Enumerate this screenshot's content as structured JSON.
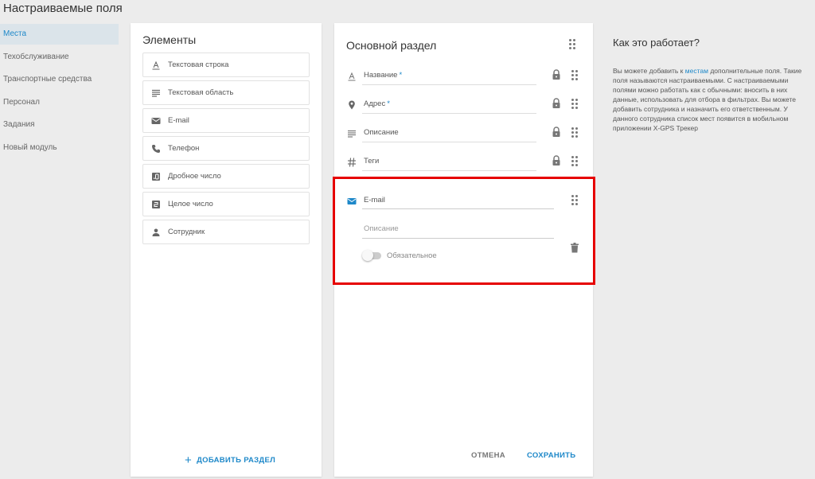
{
  "page_title": "Настраиваемые поля",
  "sidebar": {
    "items": [
      {
        "label": "Места",
        "active": true
      },
      {
        "label": "Техобслуживание"
      },
      {
        "label": "Транспортные средства"
      },
      {
        "label": "Персонал"
      },
      {
        "label": "Задания"
      },
      {
        "label": "Новый модуль"
      }
    ]
  },
  "elements_panel": {
    "title": "Элементы",
    "items": [
      {
        "label": "Текстовая строка",
        "icon": "text-line-icon"
      },
      {
        "label": "Текстовая область",
        "icon": "text-area-icon"
      },
      {
        "label": "E-mail",
        "icon": "email-icon"
      },
      {
        "label": "Телефон",
        "icon": "phone-icon"
      },
      {
        "label": "Дробное число",
        "icon": "decimal-icon"
      },
      {
        "label": "Целое число",
        "icon": "integer-icon"
      },
      {
        "label": "Сотрудник",
        "icon": "person-icon"
      }
    ],
    "add_section": "ДОБАВИТЬ РАЗДЕЛ"
  },
  "section_panel": {
    "title": "Основной раздел",
    "fields": [
      {
        "label": "Название",
        "required": "*",
        "icon": "text-line-icon"
      },
      {
        "label": "Адрес",
        "required": "*",
        "icon": "location-pin-icon"
      },
      {
        "label": "Описание",
        "required": "",
        "icon": "text-area-icon"
      },
      {
        "label": "Теги",
        "required": "",
        "icon": "hash-icon"
      }
    ],
    "editor": {
      "name_value": "E-mail",
      "description_placeholder": "Описание",
      "required_toggle_label": "Обязательное",
      "required_on": false
    },
    "cancel": "ОТМЕНА",
    "save": "СОХРАНИТЬ"
  },
  "help": {
    "title": "Как это работает?",
    "text_before": "Вы можете добавить к ",
    "link": "местам",
    "text_after": " дополнительные поля. Такие поля называются настраиваемыми. С настраиваемыми полями можно работать как с обычными: вносить в них данные, использовать для отбора в фильтрах. Вы можете добавить сотрудника и назначить его ответственным. У данного сотрудника список мест появится в мобильном приложении X-GPS Трекер"
  },
  "colors": {
    "accent": "#1e88c9",
    "highlight": "#e60000",
    "background": "#ececec"
  }
}
